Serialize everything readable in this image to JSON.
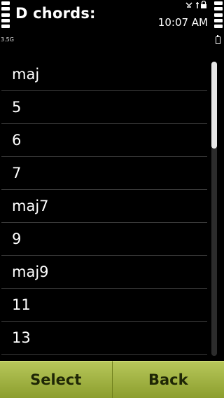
{
  "header": {
    "title": "D chords:",
    "network": "3.5G",
    "time": "10:07 AM"
  },
  "list": {
    "items": [
      "maj",
      "5",
      "6",
      "7",
      "maj7",
      "9",
      "maj9",
      "11",
      "13"
    ]
  },
  "scroll": {
    "position": 0.0
  },
  "softkeys": {
    "left_label": "Select",
    "right_label": "Back"
  },
  "colors": {
    "background": "#000000",
    "softkey": "#a2b341"
  }
}
